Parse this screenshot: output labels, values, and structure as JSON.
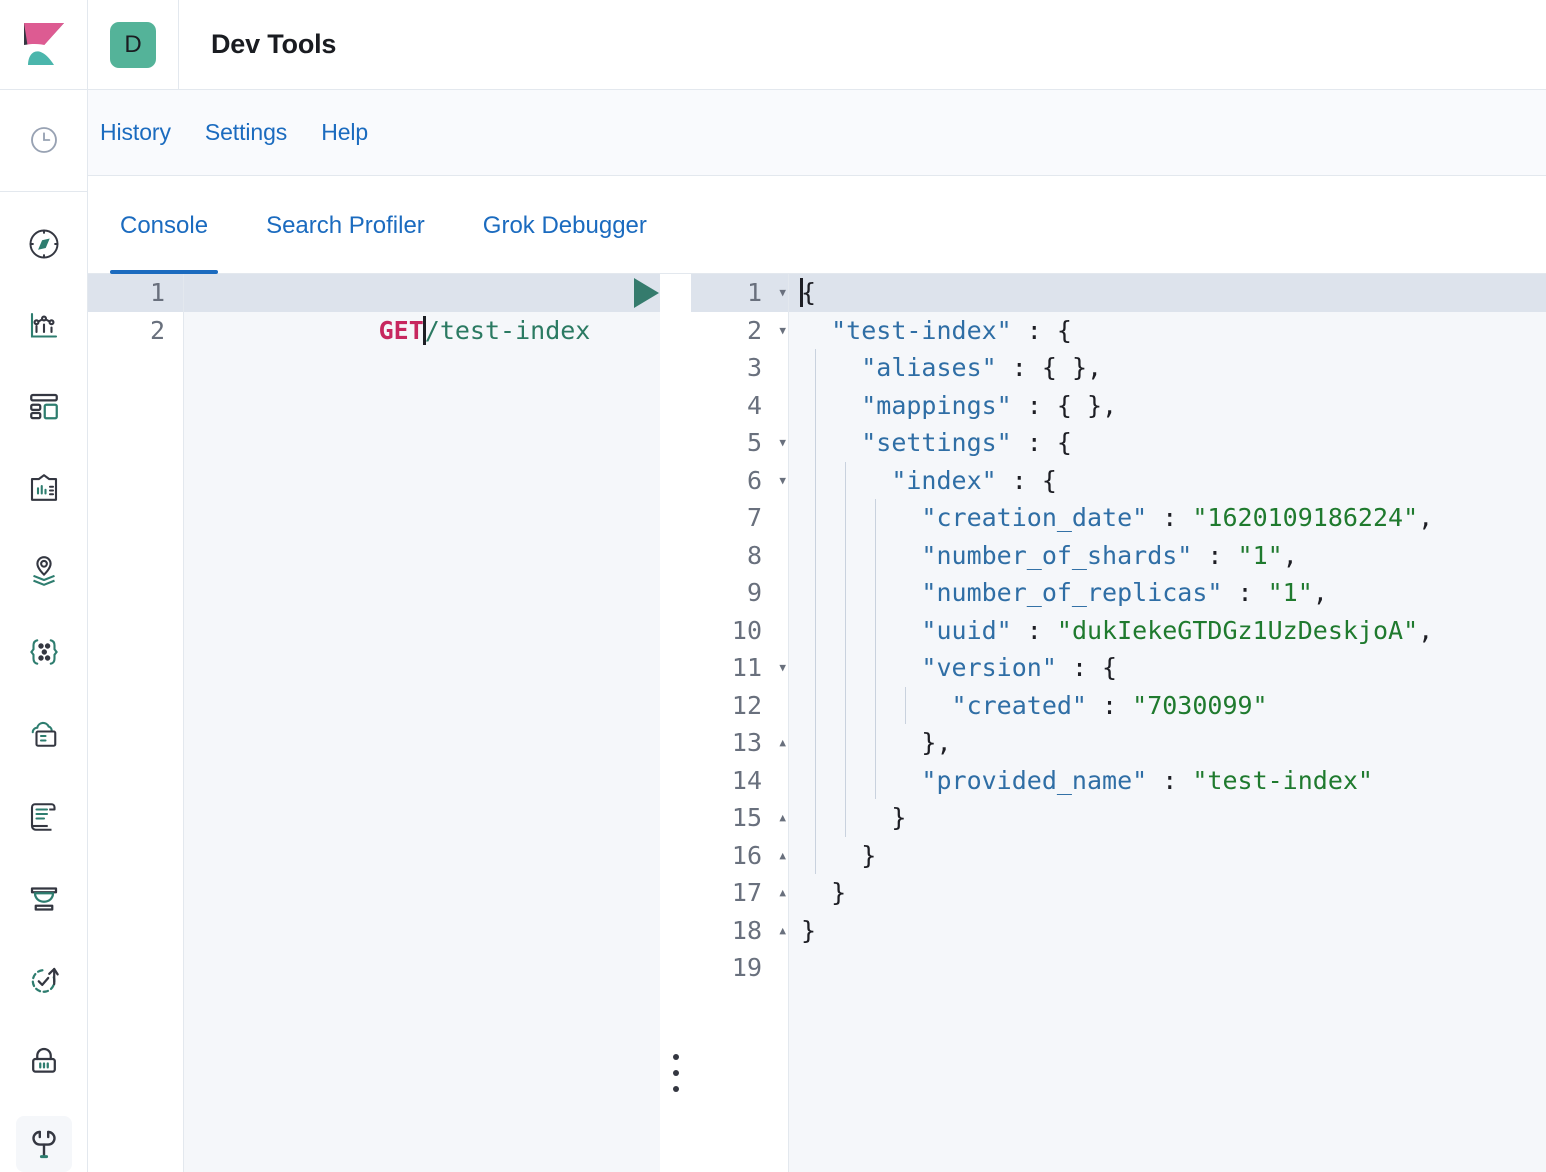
{
  "header": {
    "logo_icon": "kibana-logo",
    "app_badge_letter": "D",
    "title": "Dev Tools"
  },
  "sidenav": {
    "items": [
      {
        "icon": "recently-viewed-clock-icon",
        "name": "recently-viewed"
      },
      {
        "icon": "discover-compass-icon",
        "name": "discover"
      },
      {
        "icon": "visualize-chart-icon",
        "name": "visualize"
      },
      {
        "icon": "dashboard-icon",
        "name": "dashboard"
      },
      {
        "icon": "canvas-icon",
        "name": "canvas"
      },
      {
        "icon": "maps-layers-icon",
        "name": "maps"
      },
      {
        "icon": "machine-learning-icon",
        "name": "machine-learning"
      },
      {
        "icon": "enterprise-search-icon",
        "name": "enterprise-search"
      },
      {
        "icon": "logs-scroll-icon",
        "name": "logs"
      },
      {
        "icon": "apm-icon",
        "name": "apm"
      },
      {
        "icon": "uptime-icon",
        "name": "uptime"
      },
      {
        "icon": "security-lock-icon",
        "name": "security"
      },
      {
        "icon": "dev-tools-wrench-icon",
        "name": "dev-tools",
        "selected": true
      }
    ]
  },
  "menubar": {
    "items": [
      {
        "label": "History"
      },
      {
        "label": "Settings"
      },
      {
        "label": "Help"
      }
    ]
  },
  "tabs": [
    {
      "label": "Console",
      "active": true
    },
    {
      "label": "Search Profiler",
      "active": false
    },
    {
      "label": "Grok Debugger",
      "active": false
    }
  ],
  "editor": {
    "actions": {
      "play_icon": "play-triangle-icon",
      "wrench_icon": "wrench-icon"
    },
    "line_numbers": [
      "1",
      "2"
    ],
    "request": {
      "method": "GET",
      "url": "/test-index"
    }
  },
  "output": {
    "line_numbers": [
      "1",
      "2",
      "3",
      "4",
      "5",
      "6",
      "7",
      "8",
      "9",
      "10",
      "11",
      "12",
      "13",
      "14",
      "15",
      "16",
      "17",
      "18",
      "19"
    ],
    "folds": {
      "1": "down",
      "2": "down",
      "5": "down",
      "6": "down",
      "11": "down",
      "13": "up",
      "15": "up",
      "16": "up",
      "17": "up",
      "18": "up"
    },
    "json": {
      "test-index": {
        "aliases": {},
        "mappings": {},
        "settings": {
          "index": {
            "creation_date": "1620109186224",
            "number_of_shards": "1",
            "number_of_replicas": "1",
            "uuid": "dukIekeGTDGz1UzDeskjoA",
            "version": {
              "created": "7030099"
            },
            "provided_name": "test-index"
          }
        }
      }
    },
    "lines": [
      {
        "n": "1",
        "indent": 0,
        "guides": 0,
        "parts": [
          {
            "t": "{",
            "c": "punc"
          }
        ]
      },
      {
        "n": "2",
        "indent": 1,
        "guides": 0,
        "parts": [
          {
            "t": "\"test-index\"",
            "c": "key"
          },
          {
            "t": " : {",
            "c": "punc"
          }
        ]
      },
      {
        "n": "3",
        "indent": 2,
        "guides": 1,
        "parts": [
          {
            "t": "\"aliases\"",
            "c": "key"
          },
          {
            "t": " : { },",
            "c": "punc"
          }
        ]
      },
      {
        "n": "4",
        "indent": 2,
        "guides": 1,
        "parts": [
          {
            "t": "\"mappings\"",
            "c": "key"
          },
          {
            "t": " : { },",
            "c": "punc"
          }
        ]
      },
      {
        "n": "5",
        "indent": 2,
        "guides": 1,
        "parts": [
          {
            "t": "\"settings\"",
            "c": "key"
          },
          {
            "t": " : {",
            "c": "punc"
          }
        ]
      },
      {
        "n": "6",
        "indent": 3,
        "guides": 2,
        "parts": [
          {
            "t": "\"index\"",
            "c": "key"
          },
          {
            "t": " : {",
            "c": "punc"
          }
        ]
      },
      {
        "n": "7",
        "indent": 4,
        "guides": 3,
        "parts": [
          {
            "t": "\"creation_date\"",
            "c": "key"
          },
          {
            "t": " : ",
            "c": "punc"
          },
          {
            "t": "\"1620109186224\"",
            "c": "str"
          },
          {
            "t": ",",
            "c": "punc"
          }
        ]
      },
      {
        "n": "8",
        "indent": 4,
        "guides": 3,
        "parts": [
          {
            "t": "\"number_of_shards\"",
            "c": "key"
          },
          {
            "t": " : ",
            "c": "punc"
          },
          {
            "t": "\"1\"",
            "c": "str"
          },
          {
            "t": ",",
            "c": "punc"
          }
        ]
      },
      {
        "n": "9",
        "indent": 4,
        "guides": 3,
        "parts": [
          {
            "t": "\"number_of_replicas\"",
            "c": "key"
          },
          {
            "t": " : ",
            "c": "punc"
          },
          {
            "t": "\"1\"",
            "c": "str"
          },
          {
            "t": ",",
            "c": "punc"
          }
        ]
      },
      {
        "n": "10",
        "indent": 4,
        "guides": 3,
        "parts": [
          {
            "t": "\"uuid\"",
            "c": "key"
          },
          {
            "t": " : ",
            "c": "punc"
          },
          {
            "t": "\"dukIekeGTDGz1UzDeskjoA\"",
            "c": "str"
          },
          {
            "t": ",",
            "c": "punc"
          }
        ]
      },
      {
        "n": "11",
        "indent": 4,
        "guides": 3,
        "parts": [
          {
            "t": "\"version\"",
            "c": "key"
          },
          {
            "t": " : {",
            "c": "punc"
          }
        ]
      },
      {
        "n": "12",
        "indent": 5,
        "guides": 4,
        "parts": [
          {
            "t": "\"created\"",
            "c": "key"
          },
          {
            "t": " : ",
            "c": "punc"
          },
          {
            "t": "\"7030099\"",
            "c": "str"
          }
        ]
      },
      {
        "n": "13",
        "indent": 4,
        "guides": 3,
        "parts": [
          {
            "t": "},",
            "c": "punc"
          }
        ]
      },
      {
        "n": "14",
        "indent": 4,
        "guides": 3,
        "parts": [
          {
            "t": "\"provided_name\"",
            "c": "key"
          },
          {
            "t": " : ",
            "c": "punc"
          },
          {
            "t": "\"test-index\"",
            "c": "str"
          }
        ]
      },
      {
        "n": "15",
        "indent": 3,
        "guides": 2,
        "parts": [
          {
            "t": "}",
            "c": "punc"
          }
        ]
      },
      {
        "n": "16",
        "indent": 2,
        "guides": 1,
        "parts": [
          {
            "t": "}",
            "c": "punc"
          }
        ]
      },
      {
        "n": "17",
        "indent": 1,
        "guides": 0,
        "parts": [
          {
            "t": "}",
            "c": "punc"
          }
        ]
      },
      {
        "n": "18",
        "indent": 0,
        "guides": 0,
        "parts": [
          {
            "t": "}",
            "c": "punc"
          }
        ]
      },
      {
        "n": "19",
        "indent": 0,
        "guides": 0,
        "parts": []
      }
    ]
  },
  "resizer": {
    "handle_icon": "drag-dots-vertical-icon"
  },
  "colors": {
    "brand_blue": "#1b6bbf",
    "teal": "#54b399",
    "pink": "#dd5b92",
    "method": "#c7275f",
    "url": "#2b7a62",
    "json_key": "#2f6ea5",
    "json_string": "#1f7a2e",
    "active_line": "#dde3ec",
    "editor_bg": "#f5f7fa"
  }
}
